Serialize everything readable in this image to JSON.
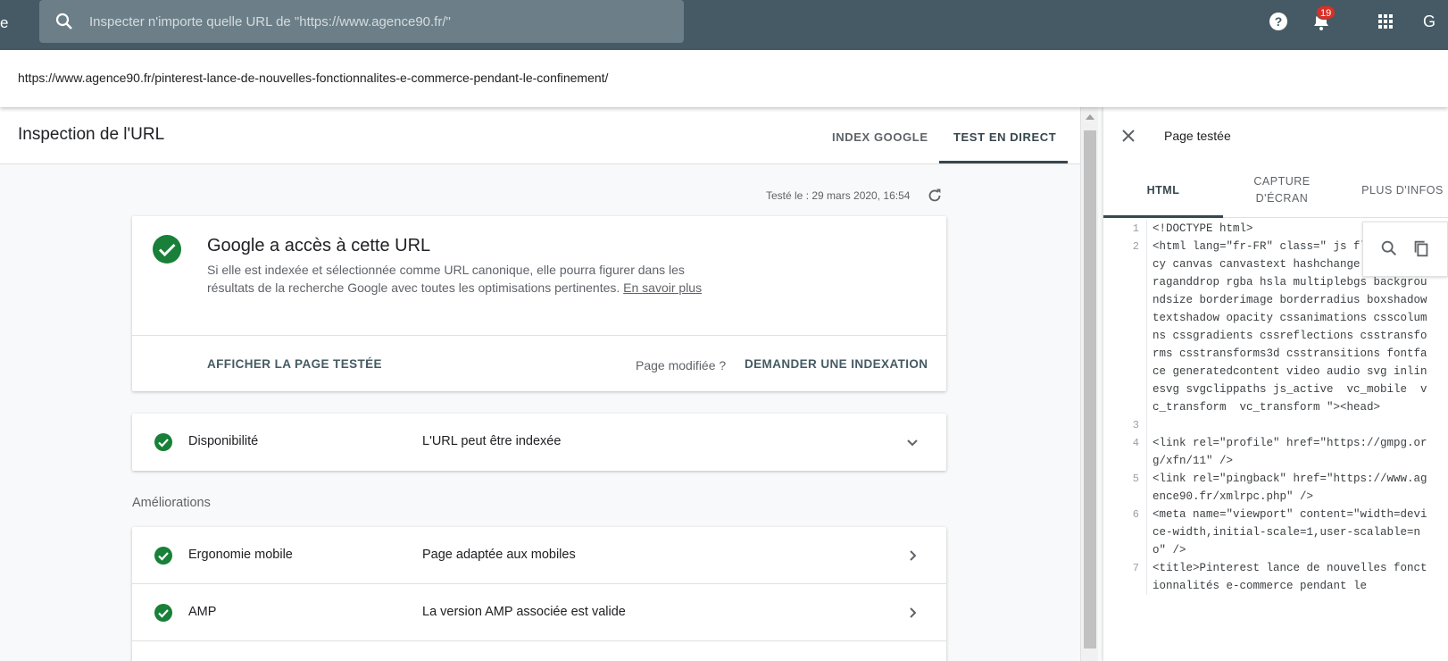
{
  "topbar": {
    "edge_char": "e",
    "search_placeholder": "Inspecter n'importe quelle URL de \"https://www.agence90.fr/\"",
    "notification_count": "19",
    "account_letter": "G"
  },
  "inspected_url": "https://www.agence90.fr/pinterest-lance-de-nouvelles-fonctionnalites-e-commerce-pendant-le-confinement/",
  "main": {
    "title": "Inspection de l'URL",
    "tabs": [
      {
        "label": "INDEX GOOGLE"
      },
      {
        "label": "TEST EN DIRECT"
      }
    ],
    "tested_at": "Testé le : 29 mars 2020, 16:54",
    "status_card": {
      "title": "Google a accès à cette URL",
      "description": "Si elle est indexée et sélectionnée comme URL canonique, elle pourra figurer dans les résultats de la recherche Google avec toutes les optimisations pertinentes. ",
      "learn_more": "En savoir plus",
      "show_page_button": "AFFICHER LA PAGE TESTÉE",
      "page_modified": "Page modifiée ?",
      "request_index_button": "DEMANDER UNE INDEXATION"
    },
    "availability": {
      "label": "Disponibilité",
      "value": "L'URL peut être indexée"
    },
    "improvements_label": "Améliorations",
    "improvements": [
      {
        "label": "Ergonomie mobile",
        "value": "Page adaptée aux mobiles"
      },
      {
        "label": "AMP",
        "value": "La version AMP associée est valide"
      }
    ]
  },
  "side_panel": {
    "title": "Page testée",
    "tabs": [
      {
        "label": "HTML"
      },
      {
        "label": "CAPTURE D'ÉCRAN"
      },
      {
        "label": "PLUS D'INFOS"
      }
    ],
    "code_lines": [
      {
        "n": "1",
        "text": "<!DOCTYPE html>"
      },
      {
        "n": "2",
        "text": "<html lang=\"fr-FR\" class=\" js flexboxlegacy canvas canvastext hashchange history draganddrop rgba hsla multiplebgs backgroundsize borderimage borderradius boxshadow textshadow opacity cssanimations csscolumns cssgradients cssreflections csstransforms csstransforms3d csstransitions fontface generatedcontent video audio svg inlinesvg svgclippaths js_active  vc_mobile  vc_transform  vc_transform \"><head>"
      },
      {
        "n": "3",
        "text": ""
      },
      {
        "n": "4",
        "text": "<link rel=\"profile\" href=\"https://gmpg.org/xfn/11\" />"
      },
      {
        "n": "5",
        "text": "<link rel=\"pingback\" href=\"https://www.agence90.fr/xmlrpc.php\" />"
      },
      {
        "n": "6",
        "text": "<meta name=\"viewport\" content=\"width=device-width,initial-scale=1,user-scalable=no\" />"
      },
      {
        "n": "7",
        "text": "<title>Pinterest lance de nouvelles fonctionnalités e-commerce pendant le"
      }
    ]
  },
  "colors": {
    "topbar": "#455a64",
    "success_green": "#188038",
    "badge_red": "#d93025",
    "accent": "#37474f"
  }
}
